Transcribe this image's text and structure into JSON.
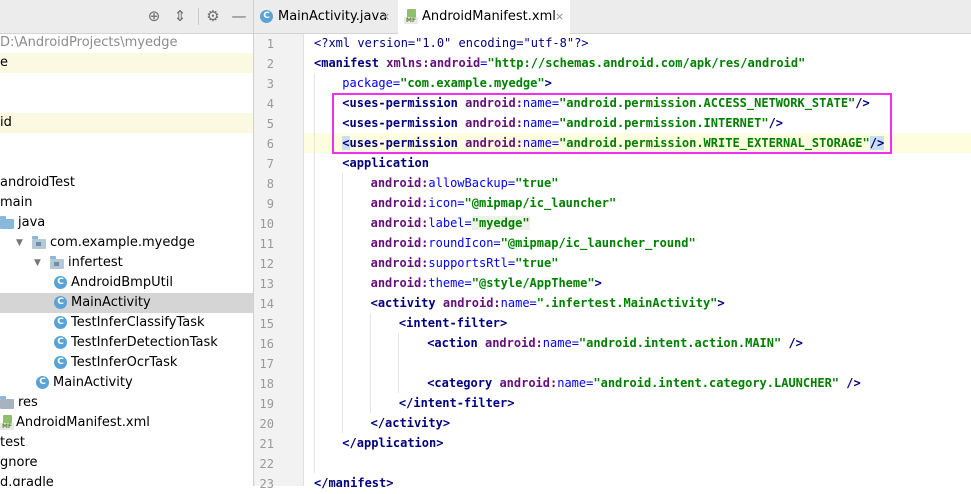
{
  "project": {
    "toolbar_icons": [
      "target-icon",
      "collapse-all-icon",
      "gear-icon",
      "minimize-icon"
    ],
    "tree": [
      {
        "text": "D:\\AndroidProjects\\myedge",
        "dim": true,
        "icon": "none",
        "indent": 0
      },
      {
        "text": "e",
        "icon": "none",
        "indent": 0,
        "highlight": "yellow"
      },
      {
        "text": "",
        "icon": "none",
        "indent": 0
      },
      {
        "text": "",
        "icon": "none",
        "indent": 0
      },
      {
        "text": "id",
        "icon": "none",
        "indent": 0,
        "highlight": "yellow"
      },
      {
        "text": "",
        "icon": "none",
        "indent": 0
      },
      {
        "text": "",
        "icon": "none",
        "indent": 0
      },
      {
        "text": "androidTest",
        "icon": "none",
        "indent": 0
      },
      {
        "text": "main",
        "icon": "none",
        "indent": 0
      },
      {
        "text": "java",
        "icon": "folder",
        "indent": 0
      },
      {
        "text": "com.example.myedge",
        "icon": "package",
        "indent": 1,
        "arrow": "▼"
      },
      {
        "text": "infertest",
        "icon": "package",
        "indent": 2,
        "arrow": "▼"
      },
      {
        "text": "AndroidBmpUtil",
        "icon": "class",
        "indent": 3
      },
      {
        "text": "MainActivity",
        "icon": "class",
        "indent": 3,
        "selected": true
      },
      {
        "text": "TestInferClassifyTask",
        "icon": "class",
        "indent": 3
      },
      {
        "text": "TestInferDetectionTask",
        "icon": "class",
        "indent": 3
      },
      {
        "text": "TestInferOcrTask",
        "icon": "class",
        "indent": 3
      },
      {
        "text": "MainActivity",
        "icon": "class",
        "indent": 2
      },
      {
        "text": "res",
        "icon": "res-folder",
        "indent": 0
      },
      {
        "text": "AndroidManifest.xml",
        "icon": "manifest",
        "indent": 0
      },
      {
        "text": "test",
        "icon": "none",
        "indent": 0
      },
      {
        "text": "gnore",
        "icon": "none",
        "indent": 0
      },
      {
        "text": "d.gradle",
        "icon": "none",
        "indent": 0
      }
    ]
  },
  "tabs": [
    {
      "label": "MainActivity.java",
      "icon": "class",
      "active": false
    },
    {
      "label": "AndroidManifest.xml",
      "icon": "manifest",
      "active": true
    }
  ],
  "tab_close_glyph": "×",
  "editor": {
    "lines": [
      {
        "n": "1",
        "indent": 0,
        "segments": [
          [
            "pi",
            "<?xml version=\"1.0\" encoding=\"utf-8\"?>"
          ]
        ]
      },
      {
        "n": "2",
        "indent": 0,
        "segments": [
          [
            "t",
            "<manifest "
          ],
          [
            "ns",
            "xmlns:android"
          ],
          [
            "an",
            "="
          ],
          [
            "av",
            "\"http://schemas.android.com/apk/res/android\""
          ]
        ]
      },
      {
        "n": "3",
        "indent": 1,
        "segments": [
          [
            "an",
            "package"
          ],
          [
            "an",
            "="
          ],
          [
            "av",
            "\"com.example.myedge\""
          ],
          [
            "t",
            ">"
          ]
        ]
      },
      {
        "n": "4",
        "indent": 1,
        "segments": [
          [
            "t",
            "<uses-permission "
          ],
          [
            "ns",
            "android:"
          ],
          [
            "an",
            "name"
          ],
          [
            "an",
            "="
          ],
          [
            "av",
            "\"android.permission.ACCESS_NETWORK_STATE\""
          ],
          [
            "t",
            "/>"
          ]
        ]
      },
      {
        "n": "5",
        "indent": 1,
        "segments": [
          [
            "t",
            "<uses-permission "
          ],
          [
            "ns",
            "android:"
          ],
          [
            "an",
            "name"
          ],
          [
            "an",
            "="
          ],
          [
            "av",
            "\"android.permission.INTERNET\""
          ],
          [
            "t",
            "/>"
          ]
        ]
      },
      {
        "n": "6",
        "indent": 1,
        "segments": [
          [
            "t tag-hl",
            "<"
          ],
          [
            "t",
            "uses-permission "
          ],
          [
            "ns",
            "android:"
          ],
          [
            "an",
            "name"
          ],
          [
            "an",
            "="
          ],
          [
            "av",
            "\"android.permission.WRITE_EXTERNAL_STORAGE\""
          ],
          [
            "t tag-hl",
            "/>"
          ]
        ]
      },
      {
        "n": "7",
        "indent": 1,
        "segments": [
          [
            "t",
            "<application"
          ]
        ]
      },
      {
        "n": "8",
        "indent": 2,
        "segments": [
          [
            "ns",
            "android:"
          ],
          [
            "an",
            "allowBackup"
          ],
          [
            "an",
            "="
          ],
          [
            "av",
            "\"true\""
          ]
        ]
      },
      {
        "n": "9",
        "indent": 2,
        "segments": [
          [
            "ns",
            "android:"
          ],
          [
            "an",
            "icon"
          ],
          [
            "an",
            "="
          ],
          [
            "av",
            "\"@mipmap/ic_launcher\""
          ]
        ]
      },
      {
        "n": "10",
        "indent": 2,
        "segments": [
          [
            "ns",
            "android:"
          ],
          [
            "an",
            "label"
          ],
          [
            "an",
            "="
          ],
          [
            "av lbl-hl",
            "\"myedge\""
          ]
        ]
      },
      {
        "n": "11",
        "indent": 2,
        "segments": [
          [
            "ns",
            "android:"
          ],
          [
            "an",
            "roundIcon"
          ],
          [
            "an",
            "="
          ],
          [
            "av",
            "\"@mipmap/ic_launcher_round\""
          ]
        ]
      },
      {
        "n": "12",
        "indent": 2,
        "segments": [
          [
            "ns",
            "android:"
          ],
          [
            "an",
            "supportsRtl"
          ],
          [
            "an",
            "="
          ],
          [
            "av",
            "\"true\""
          ]
        ]
      },
      {
        "n": "13",
        "indent": 2,
        "segments": [
          [
            "ns",
            "android:"
          ],
          [
            "an",
            "theme"
          ],
          [
            "an",
            "="
          ],
          [
            "av",
            "\"@style/AppTheme\""
          ],
          [
            "t",
            ">"
          ]
        ]
      },
      {
        "n": "14",
        "indent": 2,
        "segments": [
          [
            "t",
            "<activity "
          ],
          [
            "ns",
            "android:"
          ],
          [
            "an",
            "name"
          ],
          [
            "an",
            "="
          ],
          [
            "av",
            "\".infertest.MainActivity\""
          ],
          [
            "t",
            ">"
          ]
        ]
      },
      {
        "n": "15",
        "indent": 3,
        "segments": [
          [
            "t",
            "<intent-filter>"
          ]
        ]
      },
      {
        "n": "16",
        "indent": 4,
        "segments": [
          [
            "t",
            "<action "
          ],
          [
            "ns",
            "android:"
          ],
          [
            "an",
            "name"
          ],
          [
            "an",
            "="
          ],
          [
            "av",
            "\"android.intent.action.MAIN\""
          ],
          [
            "t",
            " />"
          ]
        ]
      },
      {
        "n": "17",
        "indent": 0,
        "segments": []
      },
      {
        "n": "18",
        "indent": 4,
        "segments": [
          [
            "t",
            "<category "
          ],
          [
            "ns",
            "android:"
          ],
          [
            "an",
            "name"
          ],
          [
            "an",
            "="
          ],
          [
            "av",
            "\"android.intent.category.LAUNCHER\""
          ],
          [
            "t",
            " />"
          ]
        ]
      },
      {
        "n": "19",
        "indent": 3,
        "segments": [
          [
            "t",
            "</intent-filter>"
          ]
        ]
      },
      {
        "n": "20",
        "indent": 2,
        "segments": [
          [
            "t",
            "</activity>"
          ]
        ]
      },
      {
        "n": "21",
        "indent": 1,
        "segments": [
          [
            "t",
            "</application>"
          ]
        ]
      },
      {
        "n": "22",
        "indent": 0,
        "segments": []
      },
      {
        "n": "23",
        "indent": 0,
        "segments": [
          [
            "t",
            "</manifest>"
          ]
        ]
      }
    ]
  },
  "colors": {
    "selection_box": "#f02ff0",
    "tag": "#000080",
    "attr_name": "#0000ff",
    "attr_value": "#008000",
    "namespace": "#660e7a"
  }
}
